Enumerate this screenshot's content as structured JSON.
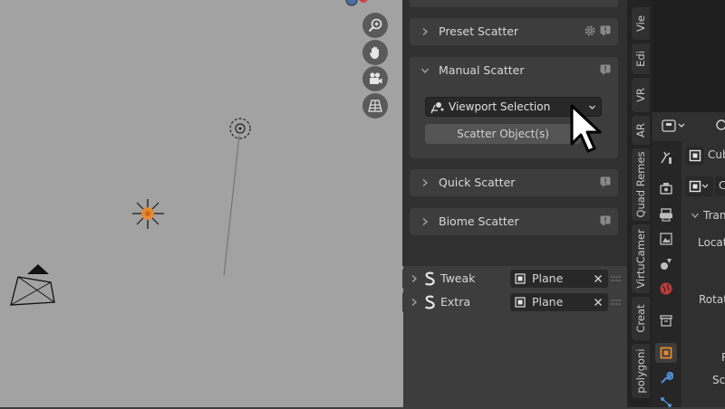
{
  "panels": {
    "preset_scatter": {
      "title": "Preset Scatter"
    },
    "manual_scatter": {
      "title": "Manual Scatter",
      "mode_value": "Viewport Selection",
      "scatter_button": "Scatter Object(s)"
    },
    "quick_scatter": {
      "title": "Quick Scatter"
    },
    "biome_scatter": {
      "title": "Biome Scatter"
    }
  },
  "subpanels": [
    {
      "label": "Tweak",
      "object": "Plane"
    },
    {
      "label": "Extra",
      "object": "Plane"
    }
  ],
  "sidebar_tabs": [
    "Vie",
    "Edi",
    "VR",
    "AR",
    "Quad Remes",
    "VirtuCamer",
    "Creat",
    "polygoni"
  ],
  "properties": {
    "object_name": "Cub",
    "field_label": "C",
    "section": "Tran",
    "location_label": "Locati",
    "rotation_label": "Rotati",
    "r_label": "R",
    "scale_label": "Sca"
  },
  "colors": {
    "accent": "#e78a33",
    "panel": "#3d3d3d",
    "viewport": "#a2a2a2"
  }
}
